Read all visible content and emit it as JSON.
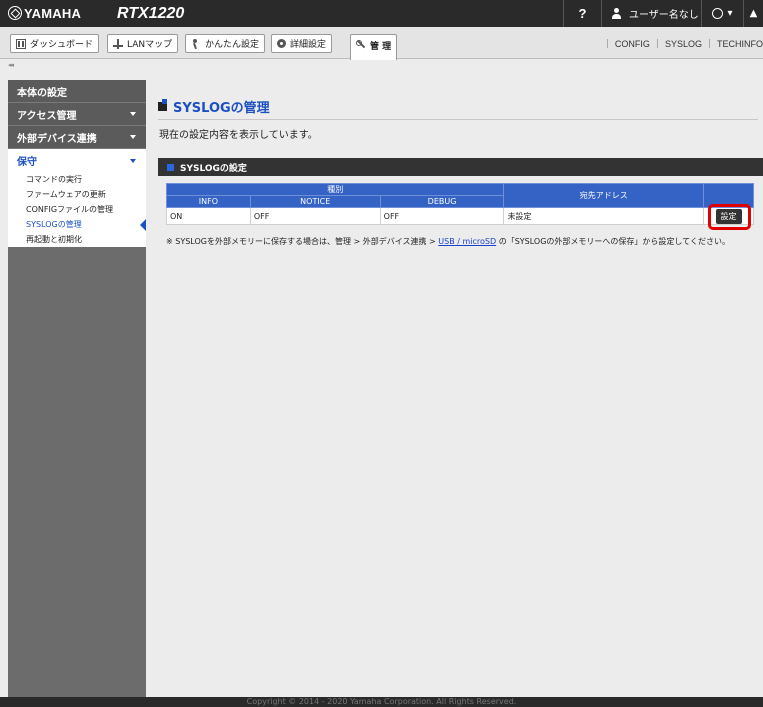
{
  "header": {
    "brand": "YAMAHA",
    "model": "RTX1220",
    "help": "?",
    "user": "ユーザー名なし"
  },
  "tabs": [
    {
      "label": "ダッシュボード",
      "icon": "dashboard-icon"
    },
    {
      "label": "LANマップ",
      "icon": "lan-map-icon"
    },
    {
      "label": "かんたん設定",
      "icon": "easy-setup-icon"
    },
    {
      "label": "詳細設定",
      "icon": "gear-icon"
    },
    {
      "label": "管 理",
      "icon": "wrench-icon"
    }
  ],
  "top_links": [
    "CONFIG",
    "SYSLOG",
    "TECHINFO"
  ],
  "collapse_label": "◂◂",
  "sidebar": {
    "sections": [
      {
        "label": "本体の設定"
      },
      {
        "label": "アクセス管理"
      },
      {
        "label": "外部デバイス連携"
      },
      {
        "label": "保守"
      }
    ],
    "items": [
      {
        "label": "コマンドの実行"
      },
      {
        "label": "ファームウェアの更新"
      },
      {
        "label": "CONFIGファイルの管理"
      },
      {
        "label": "SYSLOGの管理"
      },
      {
        "label": "再起動と初期化"
      }
    ]
  },
  "main": {
    "title": "SYSLOGの管理",
    "description": "現在の設定内容を表示しています。",
    "panel_title": "SYSLOGの設定",
    "table": {
      "group_header": "種別",
      "headers": [
        "INFO",
        "NOTICE",
        "DEBUG"
      ],
      "address_header": "宛先アドレス",
      "row": {
        "info": "ON",
        "notice": "OFF",
        "debug": "OFF",
        "address": "未設定"
      },
      "button": "設定"
    },
    "note": {
      "prefix": "※ SYSLOGを外部メモリーに保存する場合は、管理 > 外部デバイス連携 > ",
      "link": "USB / microSD",
      "suffix": " の「SYSLOGの外部メモリーへの保存」から設定してください。"
    }
  },
  "footer": "Copyright © 2014 - 2020 Yamaha Corporation. All Rights Reserved.",
  "colors": {
    "accent": "#1c50c2",
    "header_bg": "#2a2a2a",
    "table_header": "#3463c5",
    "highlight": "#e00000"
  }
}
